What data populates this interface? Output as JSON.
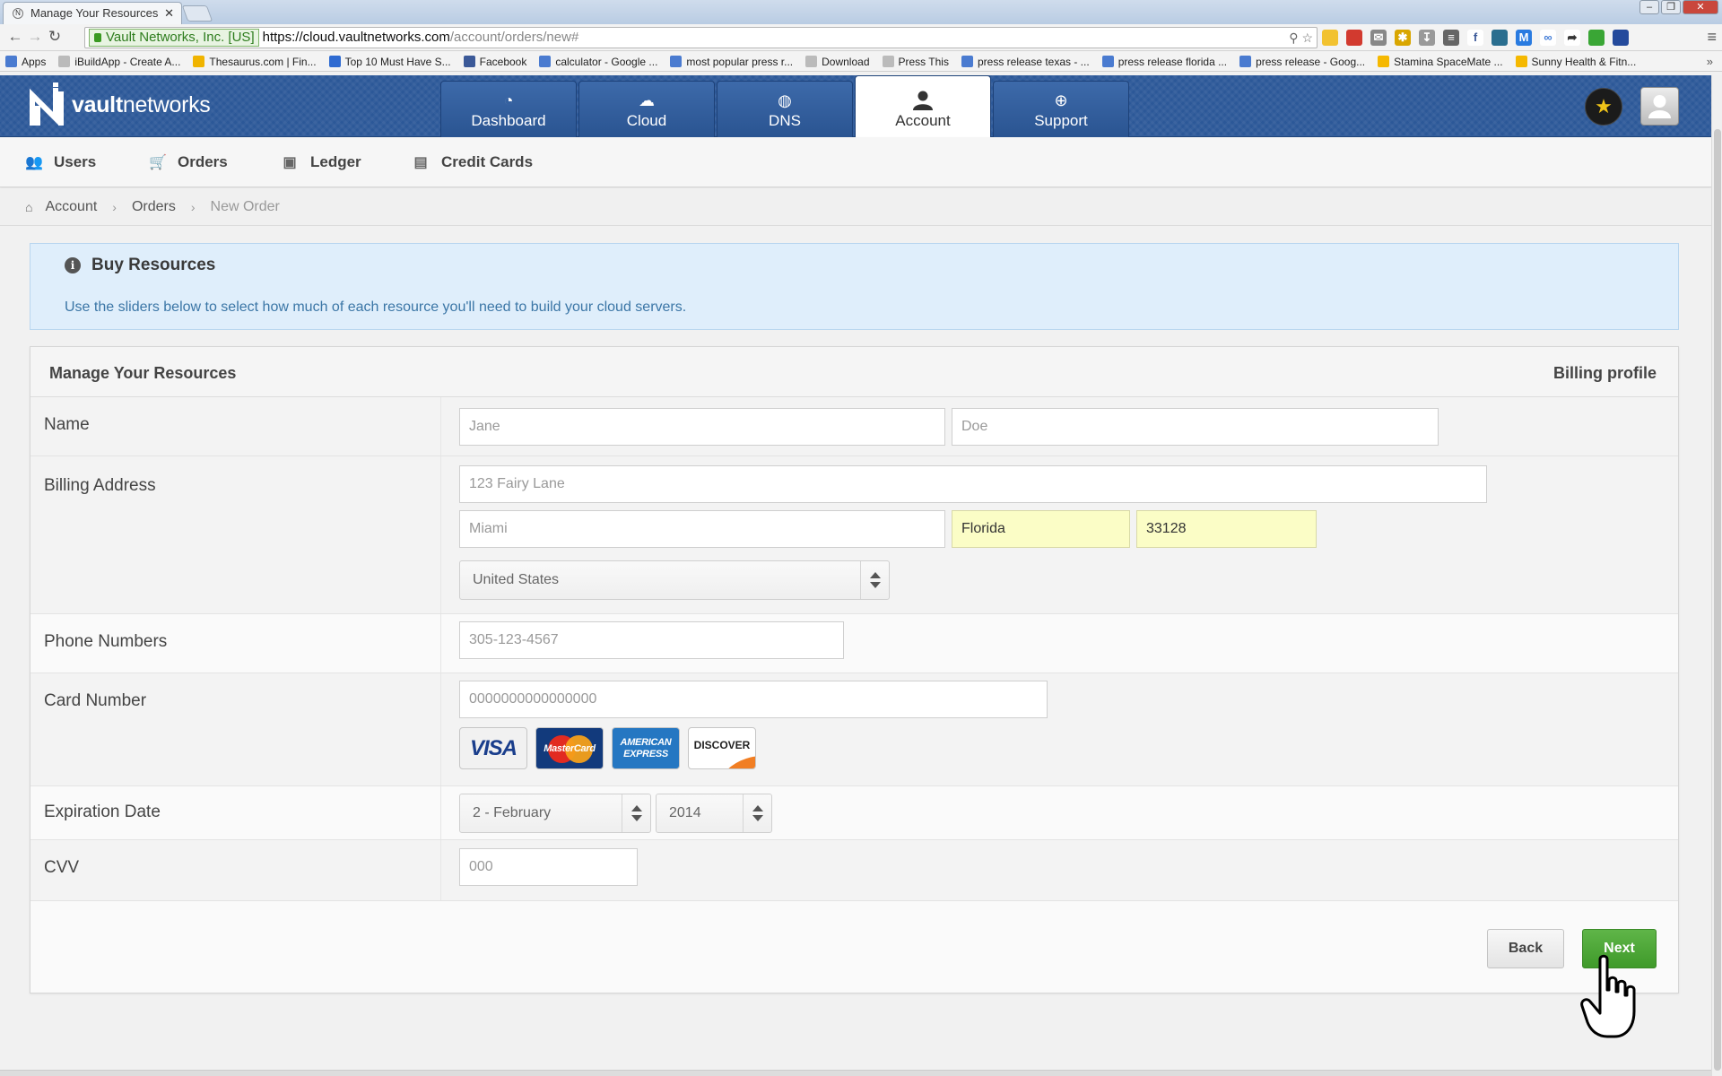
{
  "browser": {
    "tab_title": "Manage Your Resources",
    "ev_label": "Vault Networks, Inc. [US]",
    "url_scheme_host": "https://cloud.vaultnetworks.com",
    "url_path": "/account/orders/new#",
    "bookmarks": [
      {
        "label": "Apps",
        "color": "#4a7bd0"
      },
      {
        "label": "iBuildApp - Create A...",
        "color": "#bbbbbb"
      },
      {
        "label": "Thesaurus.com | Fin...",
        "color": "#f0b400"
      },
      {
        "label": "Top 10 Must Have S...",
        "color": "#2e6ad1"
      },
      {
        "label": "Facebook",
        "color": "#3b5998"
      },
      {
        "label": "calculator - Google ...",
        "color": "#4a7bd0"
      },
      {
        "label": "most popular press r...",
        "color": "#4a7bd0"
      },
      {
        "label": "Download",
        "color": "#bbbbbb"
      },
      {
        "label": "Press This",
        "color": "#bbbbbb"
      },
      {
        "label": "press release texas - ...",
        "color": "#4a7bd0"
      },
      {
        "label": "press release florida ...",
        "color": "#4a7bd0"
      },
      {
        "label": "press release - Goog...",
        "color": "#4a7bd0"
      },
      {
        "label": "Stamina SpaceMate ...",
        "color": "#f5b800"
      },
      {
        "label": "Sunny Health & Fitn...",
        "color": "#f5b800"
      }
    ]
  },
  "header": {
    "logo_text_bold": "vault",
    "logo_text": "networks",
    "nav": [
      {
        "label": "Dashboard",
        "icon": "dashboard-icon"
      },
      {
        "label": "Cloud",
        "icon": "cloud-icon"
      },
      {
        "label": "DNS",
        "icon": "globe-icon"
      },
      {
        "label": "Account",
        "icon": "user-icon"
      },
      {
        "label": "Support",
        "icon": "lifebuoy-icon"
      }
    ],
    "active_nav": "Account"
  },
  "subnav": [
    {
      "label": "Users",
      "icon": "users-icon"
    },
    {
      "label": "Orders",
      "icon": "cart-icon"
    },
    {
      "label": "Ledger",
      "icon": "ledger-icon"
    },
    {
      "label": "Credit Cards",
      "icon": "credit-card-icon"
    }
  ],
  "breadcrumb": [
    "Account",
    "Orders",
    "New Order"
  ],
  "alert": {
    "title": "Buy Resources",
    "text": "Use the sliders below to select how much of each resource you'll need to build your cloud servers."
  },
  "panel": {
    "title": "Manage Your Resources",
    "right_label": "Billing profile"
  },
  "form": {
    "name_label": "Name",
    "first_name_placeholder": "Jane",
    "last_name_placeholder": "Doe",
    "address_label": "Billing Address",
    "street_placeholder": "123 Fairy Lane",
    "city_placeholder": "Miami",
    "state_value": "Florida",
    "zip_value": "33128",
    "country_value": "United States",
    "phone_label": "Phone Numbers",
    "phone_placeholder": "305-123-4567",
    "card_label": "Card Number",
    "card_placeholder": "0000000000000000",
    "card_brands": [
      "VISA",
      "MasterCard",
      "AMERICAN EXPRESS",
      "DISCOVER"
    ],
    "exp_label": "Expiration Date",
    "exp_month": "2 - February",
    "exp_year": "2014",
    "cvv_label": "CVV",
    "cvv_placeholder": "000"
  },
  "buttons": {
    "back": "Back",
    "next": "Next"
  },
  "colors": {
    "header_blue": "#2c5898",
    "next_green": "#4aa834",
    "alert_bg": "#dfeefb",
    "autofill_yellow": "#fbfdc6"
  }
}
